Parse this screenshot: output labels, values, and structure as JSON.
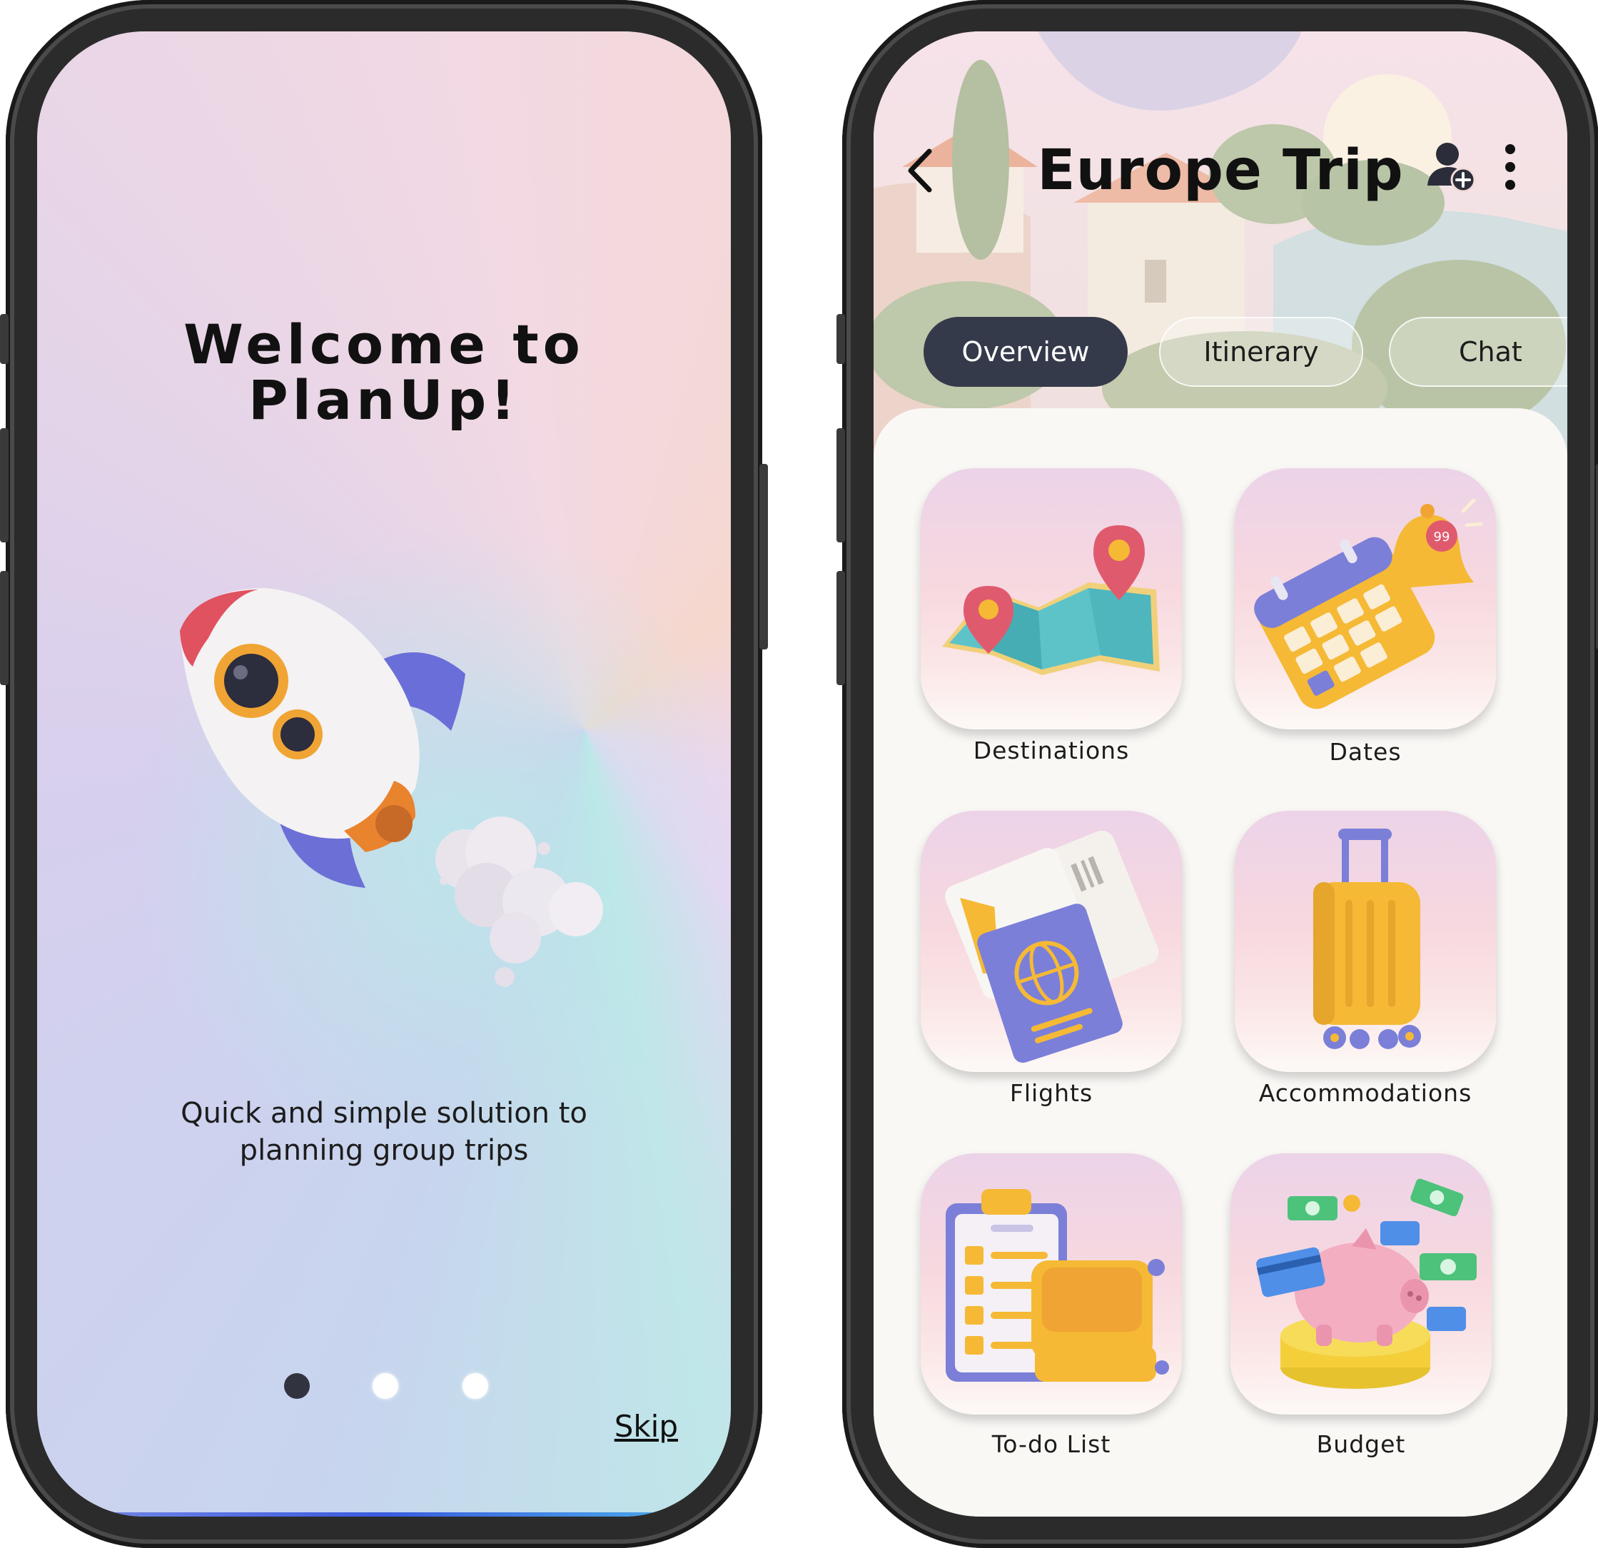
{
  "onboarding": {
    "title_line1": "Welcome to",
    "title_line2": "PlanUp!",
    "tagline_line1": "Quick and simple solution to",
    "tagline_line2": "planning group trips",
    "pager": {
      "count": 3,
      "active_index": 0
    },
    "skip_label": "Skip"
  },
  "trip": {
    "title": "Europe Trip",
    "tabs": [
      {
        "label": "Overview",
        "active": true
      },
      {
        "label": "Itinerary",
        "active": false
      },
      {
        "label": "Chat",
        "active": false
      }
    ],
    "cards": [
      {
        "label": "Destinations",
        "icon": "map-pins-icon"
      },
      {
        "label": "Dates",
        "icon": "calendar-bell-icon"
      },
      {
        "label": "Flights",
        "icon": "passport-tickets-icon"
      },
      {
        "label": "Accommodations",
        "icon": "suitcase-icon"
      },
      {
        "label": "To-do List",
        "icon": "clipboard-luggage-icon"
      },
      {
        "label": "Budget",
        "icon": "piggy-bank-icon"
      }
    ],
    "notification_badge": "99"
  },
  "colors": {
    "tab_active_bg": "#353a4b",
    "accent_yellow": "#f5b935",
    "accent_purple": "#7b7fd8",
    "pin_red": "#e05a6e"
  }
}
